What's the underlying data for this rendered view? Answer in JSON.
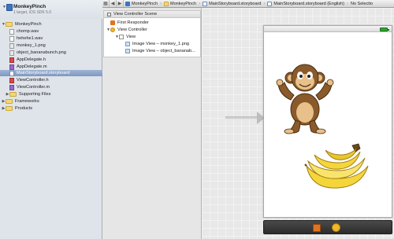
{
  "jumpbar": {
    "crumbs": [
      "MonkeyPinch",
      "MonkeyPinch",
      "MainStoryboard.storyboard",
      "MainStoryboard.storyboard (English)",
      "No Selectio"
    ]
  },
  "navigator": {
    "project": {
      "name": "MonkeyPinch",
      "subtitle": "1 target, iOS SDK 5.0"
    },
    "items": [
      {
        "label": "MonkeyPinch",
        "kind": "folder"
      },
      {
        "label": "chomp.wav",
        "kind": "file"
      },
      {
        "label": "hehehe1.wav",
        "kind": "file"
      },
      {
        "label": "monkey_1.png",
        "kind": "png"
      },
      {
        "label": "object_bananabunch.png",
        "kind": "png"
      },
      {
        "label": "AppDelegate.h",
        "kind": "h"
      },
      {
        "label": "AppDelegate.m",
        "kind": "m"
      },
      {
        "label": "MainStoryboard.storyboard",
        "kind": "storyboard",
        "selected": true
      },
      {
        "label": "ViewController.h",
        "kind": "h"
      },
      {
        "label": "ViewController.m",
        "kind": "m"
      },
      {
        "label": "Supporting Files",
        "kind": "folder"
      },
      {
        "label": "Frameworks",
        "kind": "folder"
      },
      {
        "label": "Products",
        "kind": "folder"
      }
    ]
  },
  "outline": {
    "header": "View Controller Scene",
    "items": [
      "First Responder",
      "View Controller",
      "View",
      "Image View – monkey_1.png",
      "Image View – object_bananab..."
    ]
  },
  "colors": {
    "accent": "#7f98c0",
    "banana": "#f5d63a",
    "monkey": "#8a5a2b"
  }
}
